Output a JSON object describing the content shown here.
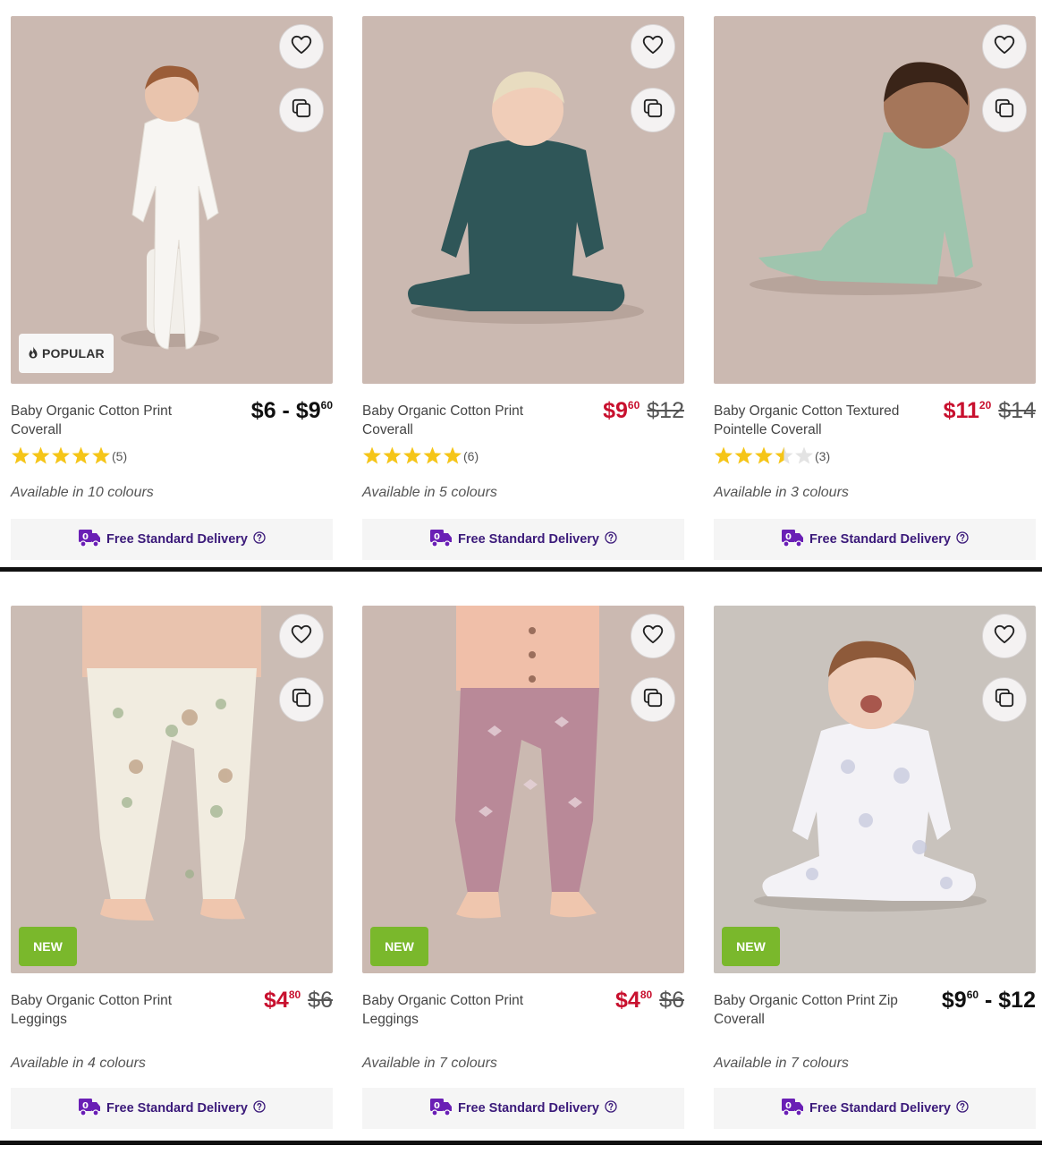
{
  "products": [
    {
      "title": "Baby Organic Cotton Print Coverall",
      "badge": "POPULAR",
      "price_type": "range",
      "price_now_main": "$6 - $9",
      "price_now_cents": "60",
      "price_was": "",
      "rating_stars": 5,
      "review_count": "(5)",
      "colours": "Available in 10 colours",
      "delivery": "Free Standard Delivery",
      "photo": {
        "bg": "#cbb9b1",
        "garment": "#f7f5f2",
        "skin": "#e9c4ad",
        "hair": "#9b5d38"
      }
    },
    {
      "title": "Baby Organic Cotton Print Coverall",
      "badge": "",
      "price_type": "sale",
      "price_now_main": "$9",
      "price_now_cents": "60",
      "price_was": "$12",
      "rating_stars": 5,
      "review_count": "(6)",
      "colours": "Available in 5 colours",
      "delivery": "Free Standard Delivery",
      "photo": {
        "bg": "#cbb9b1",
        "garment": "#2f5658",
        "skin": "#f0cdb8",
        "hair": "#e8dcc0"
      }
    },
    {
      "title": "Baby Organic Cotton Textured Pointelle Coverall",
      "badge": "",
      "price_type": "sale",
      "price_now_main": "$11",
      "price_now_cents": "20",
      "price_was": "$14",
      "rating_stars": 3.5,
      "review_count": "(3)",
      "colours": "Available in 3 colours",
      "delivery": "Free Standard Delivery",
      "photo": {
        "bg": "#cbb9b1",
        "garment": "#9fc5ae",
        "skin": "#a5765a",
        "hair": "#3a2418"
      }
    },
    {
      "title": "Baby Organic Cotton Print Leggings",
      "badge": "NEW",
      "price_type": "sale",
      "price_now_main": "$4",
      "price_now_cents": "80",
      "price_was": "$6",
      "rating_stars": 0,
      "review_count": "",
      "colours": "Available in 4 colours",
      "delivery": "Free Standard Delivery",
      "photo": {
        "bg": "#cbbcb4",
        "garment": "#f1ece0",
        "skin": "#efc6ae",
        "hair": ""
      }
    },
    {
      "title": "Baby Organic Cotton Print Leggings",
      "badge": "NEW",
      "price_type": "sale",
      "price_now_main": "$4",
      "price_now_cents": "80",
      "price_was": "$6",
      "rating_stars": 0,
      "review_count": "",
      "colours": "Available in 7 colours",
      "delivery": "Free Standard Delivery",
      "photo": {
        "bg": "#cbb9b1",
        "garment": "#b98998",
        "skin": "#efc6ae",
        "hair": ""
      }
    },
    {
      "title": "Baby Organic Cotton Print Zip Coverall",
      "badge": "NEW",
      "price_type": "range",
      "price_now_main": "$9",
      "price_now_cents": "60",
      "price_range_end": " - $12",
      "price_was": "",
      "rating_stars": 0,
      "review_count": "",
      "colours": "Available in 7 colours",
      "delivery": "Free Standard Delivery",
      "photo": {
        "bg": "#c9c3bd",
        "garment": "#f3f2f6",
        "skin": "#efcdb9",
        "hair": "#8e5a3a"
      }
    }
  ],
  "colors": {
    "sale_red": "#c8102e",
    "delivery_purple": "#3b1a7a",
    "new_green": "#7ab82c",
    "star_gold": "#f5c518"
  },
  "icons": {
    "wishlist": "heart-icon",
    "quick_view": "copy-squares-icon",
    "popular": "flame-icon",
    "delivery": "truck-icon",
    "info": "question-circle-icon"
  }
}
